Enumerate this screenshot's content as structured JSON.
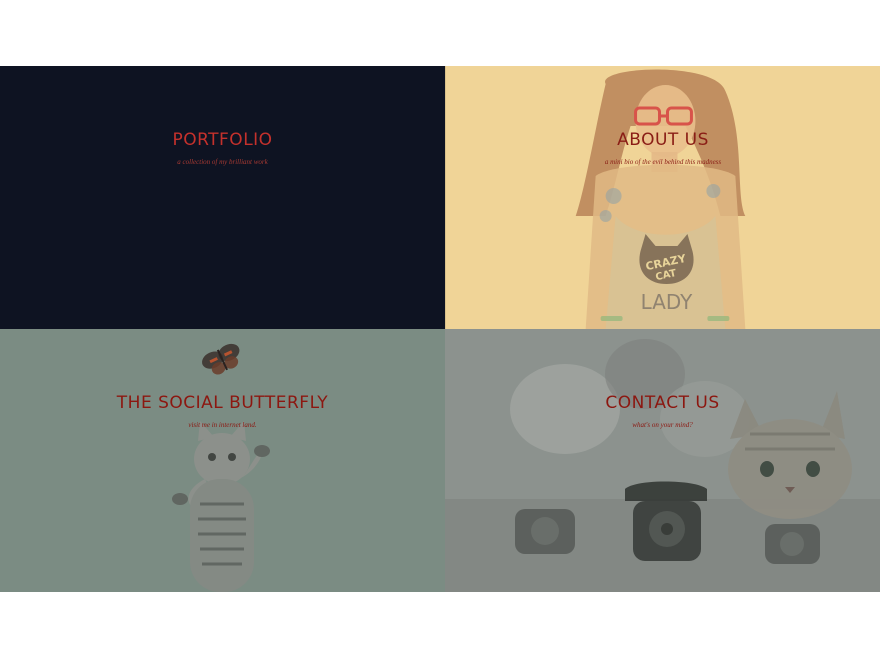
{
  "tiles": {
    "portfolio": {
      "title": "PORTFOLIO",
      "subtitle": "a collection of my brilliant work"
    },
    "about": {
      "title": "ABOUT US",
      "subtitle": "a mini bio of the evil behind this madness",
      "shirt_text_line1": "CRAZY",
      "shirt_text_line2": "CAT",
      "shirt_text_line3": "LADY"
    },
    "social": {
      "title": "THE SOCIAL BUTTERFLY",
      "subtitle": "visit me in internet land."
    },
    "contact": {
      "title": "CONTACT US",
      "subtitle": "what's on your mind?"
    }
  },
  "colors": {
    "portfolio_bg": "#0e1322",
    "about_bg": "#f0d497",
    "social_bg": "#7b8c83",
    "contact_bg": "#8c928e",
    "title_red": "#8c1710"
  },
  "icons": {
    "about_art": "crazy-cat-lady-illustration",
    "social_art": "butterfly-and-kitten-photo",
    "contact_art": "kittens-and-telephone-photo"
  }
}
